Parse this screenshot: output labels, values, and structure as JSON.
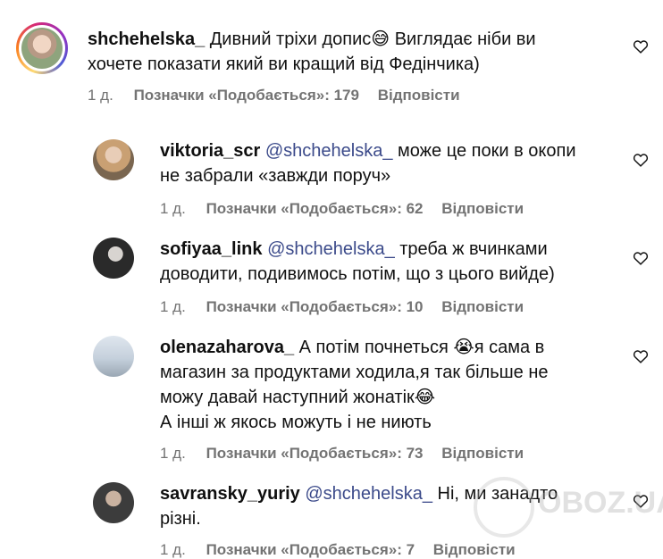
{
  "comments": [
    {
      "username": "shchehelska_",
      "line1": "Дивний тріхи допис😅 Виглядає ніби ви",
      "line2": "хочете показати який ви кращий від Федінчика)",
      "time": "1 д.",
      "likes": "Позначки «Подобається»: 179",
      "reply": "Відповісти"
    },
    {
      "username": "viktoria_scr",
      "mention": "@shchehelska_",
      "line1": "може це поки в окопи",
      "line2": "не забрали «завжди поруч»",
      "time": "1 д.",
      "likes": "Позначки «Подобається»: 62",
      "reply": "Відповісти"
    },
    {
      "username": "sofiyaa_link",
      "mention": "@shchehelska_",
      "line1": "треба ж вчинками",
      "line2": "доводити, подивимось потім, що з цього вийде)",
      "time": "1 д.",
      "likes": "Позначки «Подобається»: 10",
      "reply": "Відповісти"
    },
    {
      "username": "olenazaharova_",
      "line1": "А потім почнеться 😭я сама в",
      "line2": "магазин за продуктами ходила,я так більше не",
      "line3": "можу давай наступний жонатік😂",
      "line4": "А інші ж якось можуть і не ниють",
      "time": "1 д.",
      "likes": "Позначки «Подобається»: 73",
      "reply": "Відповісти"
    },
    {
      "username": "savransky_yuriy",
      "mention": "@shchehelska_",
      "line1": "Ні, ми занадто",
      "line2": "різні.",
      "time": "1 д.",
      "likes": "Позначки «Подобається»: 7",
      "reply": "Відповісти"
    }
  ],
  "watermark": "OBOZ.UA",
  "icons": {
    "like": "heart-outline-icon"
  }
}
